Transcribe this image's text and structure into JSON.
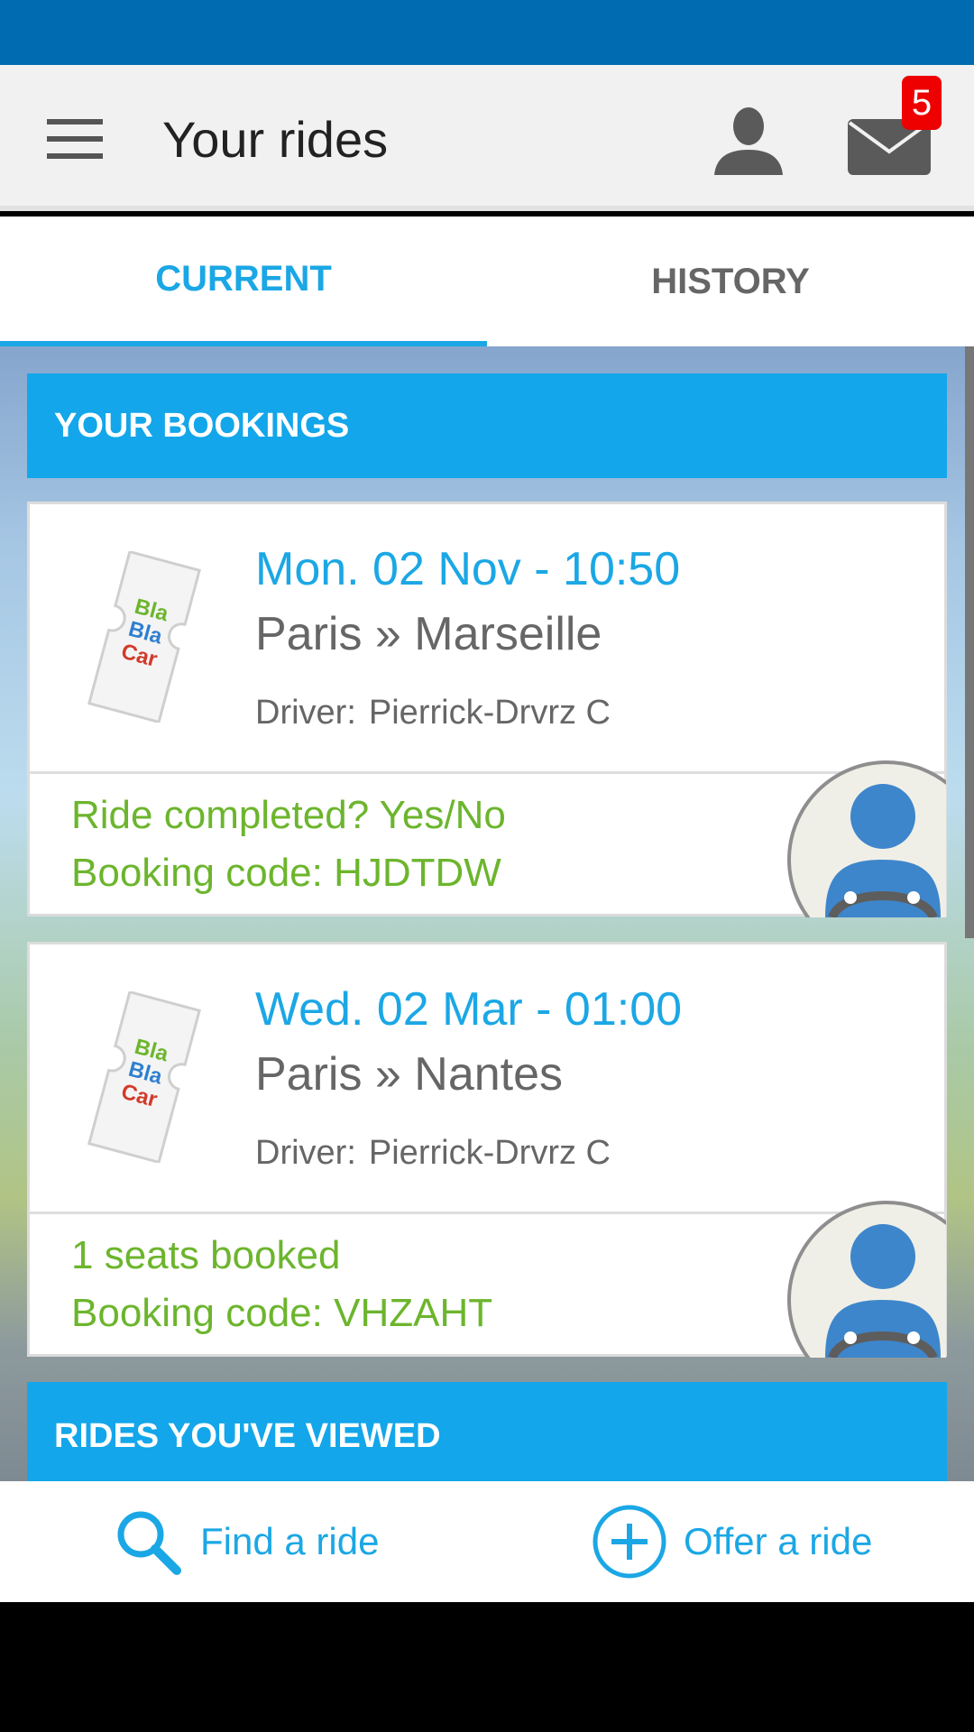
{
  "app_bar": {
    "title": "Your rides",
    "mail_badge": "5"
  },
  "tabs": [
    {
      "label": "CURRENT",
      "selected": true
    },
    {
      "label": "HISTORY",
      "selected": false
    }
  ],
  "bookings_section": {
    "title": "YOUR BOOKINGS"
  },
  "bookings": [
    {
      "date": "Mon. 02 Nov - 10:50",
      "route": "Paris » Marseille",
      "driver_label": "Driver:",
      "driver_name": "Pierrick-Drvrz C",
      "status": "Ride completed? Yes/No",
      "booking_code": "Booking code: HJDTDW"
    },
    {
      "date": "Wed. 02 Mar - 01:00",
      "route": "Paris » Nantes",
      "driver_label": "Driver:",
      "driver_name": "Pierrick-Drvrz C",
      "status": "1 seats booked",
      "booking_code": "Booking code: VHZAHT"
    }
  ],
  "ticket_logo": {
    "line1": "Bla",
    "line2": "Bla",
    "line3": "Car"
  },
  "viewed_section": {
    "title": "RIDES YOU'VE VIEWED"
  },
  "bottom_bar": {
    "find_label": "Find a ride",
    "offer_label": "Offer a ride"
  },
  "icons": {
    "menu": "hamburger-icon",
    "profile": "person-icon",
    "mail": "envelope-icon",
    "find": "magnifier-icon",
    "offer": "plus-circle-icon"
  },
  "colors": {
    "status_bar": "#006bb0",
    "accent": "#1ba7e5",
    "section_header": "#13a6ea",
    "status_green": "#6cb52d",
    "badge_red": "#ee0000"
  }
}
